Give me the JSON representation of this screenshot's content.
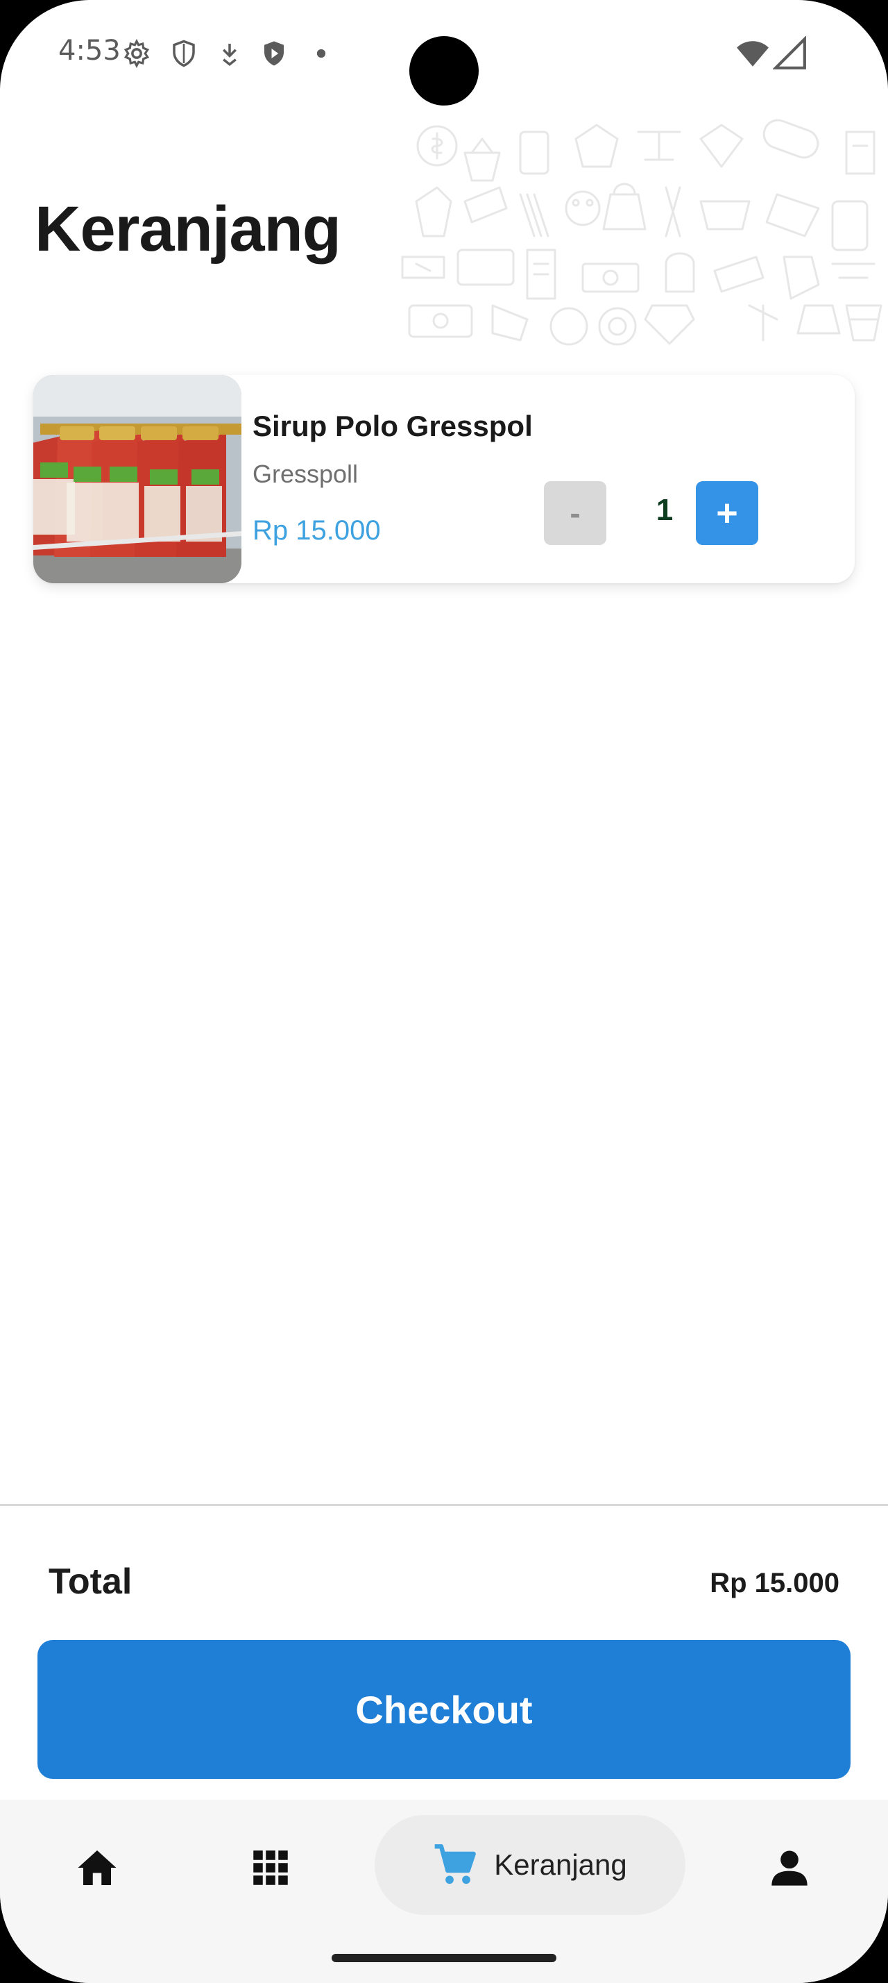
{
  "status_bar": {
    "time": "4:53",
    "icons": [
      "gear-icon",
      "shield-icon",
      "download-icon",
      "play-shield-icon",
      "dot-icon",
      "wifi-icon",
      "signal-icon"
    ]
  },
  "header": {
    "title": "Keranjang"
  },
  "cart": {
    "items": [
      {
        "name": "Sirup Polo Gresspol",
        "seller": "Gresspoll",
        "price": "Rp 15.000",
        "quantity": "1",
        "minus_label": "-",
        "plus_label": "+"
      }
    ]
  },
  "summary": {
    "total_label": "Total",
    "total_value": "Rp 15.000",
    "checkout_label": "Checkout"
  },
  "bottom_nav": {
    "items": [
      {
        "icon": "home-icon"
      },
      {
        "icon": "grid-icon"
      },
      {
        "icon": "cart-icon",
        "label": "Keranjang",
        "active": true
      },
      {
        "icon": "person-icon"
      }
    ]
  },
  "colors": {
    "accent": "#1f7fd6",
    "price": "#3fa2e0",
    "plus_button": "#3493e6",
    "minus_button": "#d9d9d9"
  }
}
